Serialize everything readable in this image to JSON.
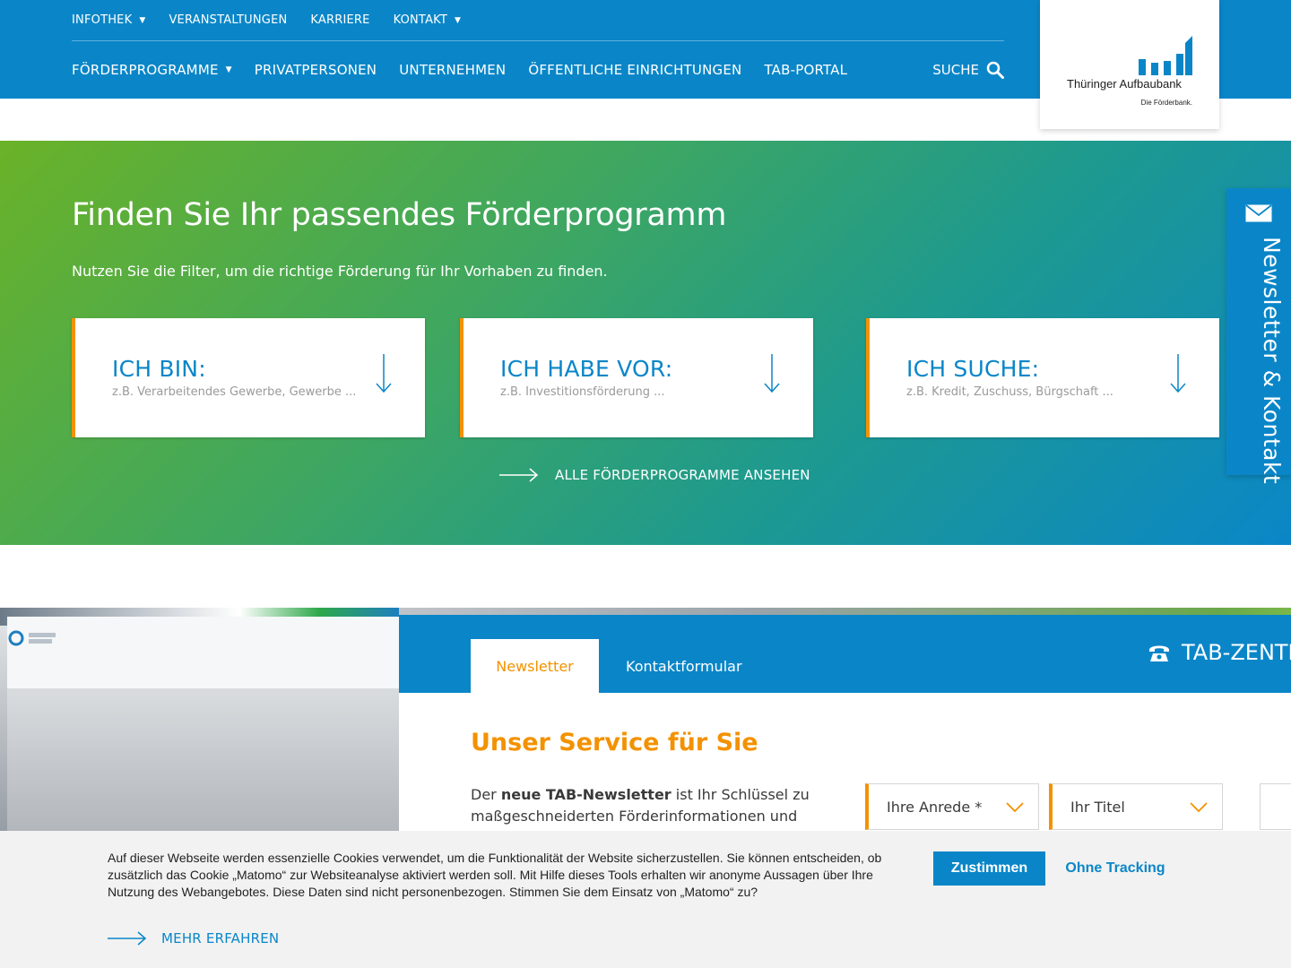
{
  "header": {
    "top_nav": [
      {
        "label": "INFOTHEK",
        "has_dropdown": true
      },
      {
        "label": "VERANSTALTUNGEN",
        "has_dropdown": false
      },
      {
        "label": "KARRIERE",
        "has_dropdown": false
      },
      {
        "label": "KONTAKT",
        "has_dropdown": true
      }
    ],
    "main_nav": [
      {
        "label": "FÖRDERPROGRAMME",
        "has_dropdown": true
      },
      {
        "label": "PRIVATPERSONEN",
        "has_dropdown": false
      },
      {
        "label": "UNTERNEHMEN",
        "has_dropdown": false
      },
      {
        "label": "ÖFFENTLICHE EINRICHTUNGEN",
        "has_dropdown": false
      },
      {
        "label": "TAB-PORTAL",
        "has_dropdown": false
      }
    ],
    "search_label": "SUCHE",
    "caret": "▼",
    "logo": {
      "name": "Thüringer Aufbaubank",
      "tagline": "Die Förderbank."
    }
  },
  "hero": {
    "title": "Finden Sie Ihr passendes Förderprogramm",
    "subtitle": "Nutzen Sie die Filter, um die richtige Förderung für Ihr Vorhaben zu finden.",
    "filters": [
      {
        "title": "ICH BIN:",
        "hint": "z.B. Verarbeitendes Gewerbe, Gewerbe ..."
      },
      {
        "title": "ICH HABE VOR:",
        "hint": "z.B. Investitionsförderung ..."
      },
      {
        "title": "ICH SUCHE:",
        "hint": "z.B. Kredit, Zuschuss, Bürgschaft ..."
      }
    ],
    "all_link": "ALLE FÖRDERPROGRAMME ANSEHEN"
  },
  "side_tab": {
    "label": "Newsletter & Kontakt",
    "icon": "mail-icon"
  },
  "newsletter": {
    "tabs": [
      {
        "label": "Newsletter",
        "active": true
      },
      {
        "label": "Kontaktformular",
        "active": false
      }
    ],
    "phone_label": "TAB-ZENTRALE",
    "title": "Unser Service für Sie",
    "text_prefix": "Der ",
    "text_bold": "neue TAB-Newsletter",
    "text_rest": " ist Ihr Schlüssel zu maßgeschneiderten Förderinformationen und",
    "selects": [
      {
        "value": "Ihre Anrede *"
      },
      {
        "value": "Ihr Titel"
      }
    ]
  },
  "cookie": {
    "text": "Auf dieser Webseite werden essenzielle Cookies verwendet, um die Funktionalität der Website sicherzustellen. Sie können entscheiden, ob zusätzlich das Cookie „Matomo“ zur Websiteanalyse aktiviert werden soll. Mit Hilfe dieses Tools erhalten wir anonyme Aussagen über Ihre Nutzung des Webangebotes. Diese Daten sind nicht personenbezogen. Stimmen Sie dem Einsatz von „Matomo“ zu?",
    "more_link": "MEHR ERFAHREN",
    "accept_label": "Zustimmen",
    "no_tracking_label": "Ohne Tracking"
  },
  "colors": {
    "primary_blue": "#0a86c8",
    "accent_orange": "#f39200",
    "hero_green": "#6ab228"
  }
}
